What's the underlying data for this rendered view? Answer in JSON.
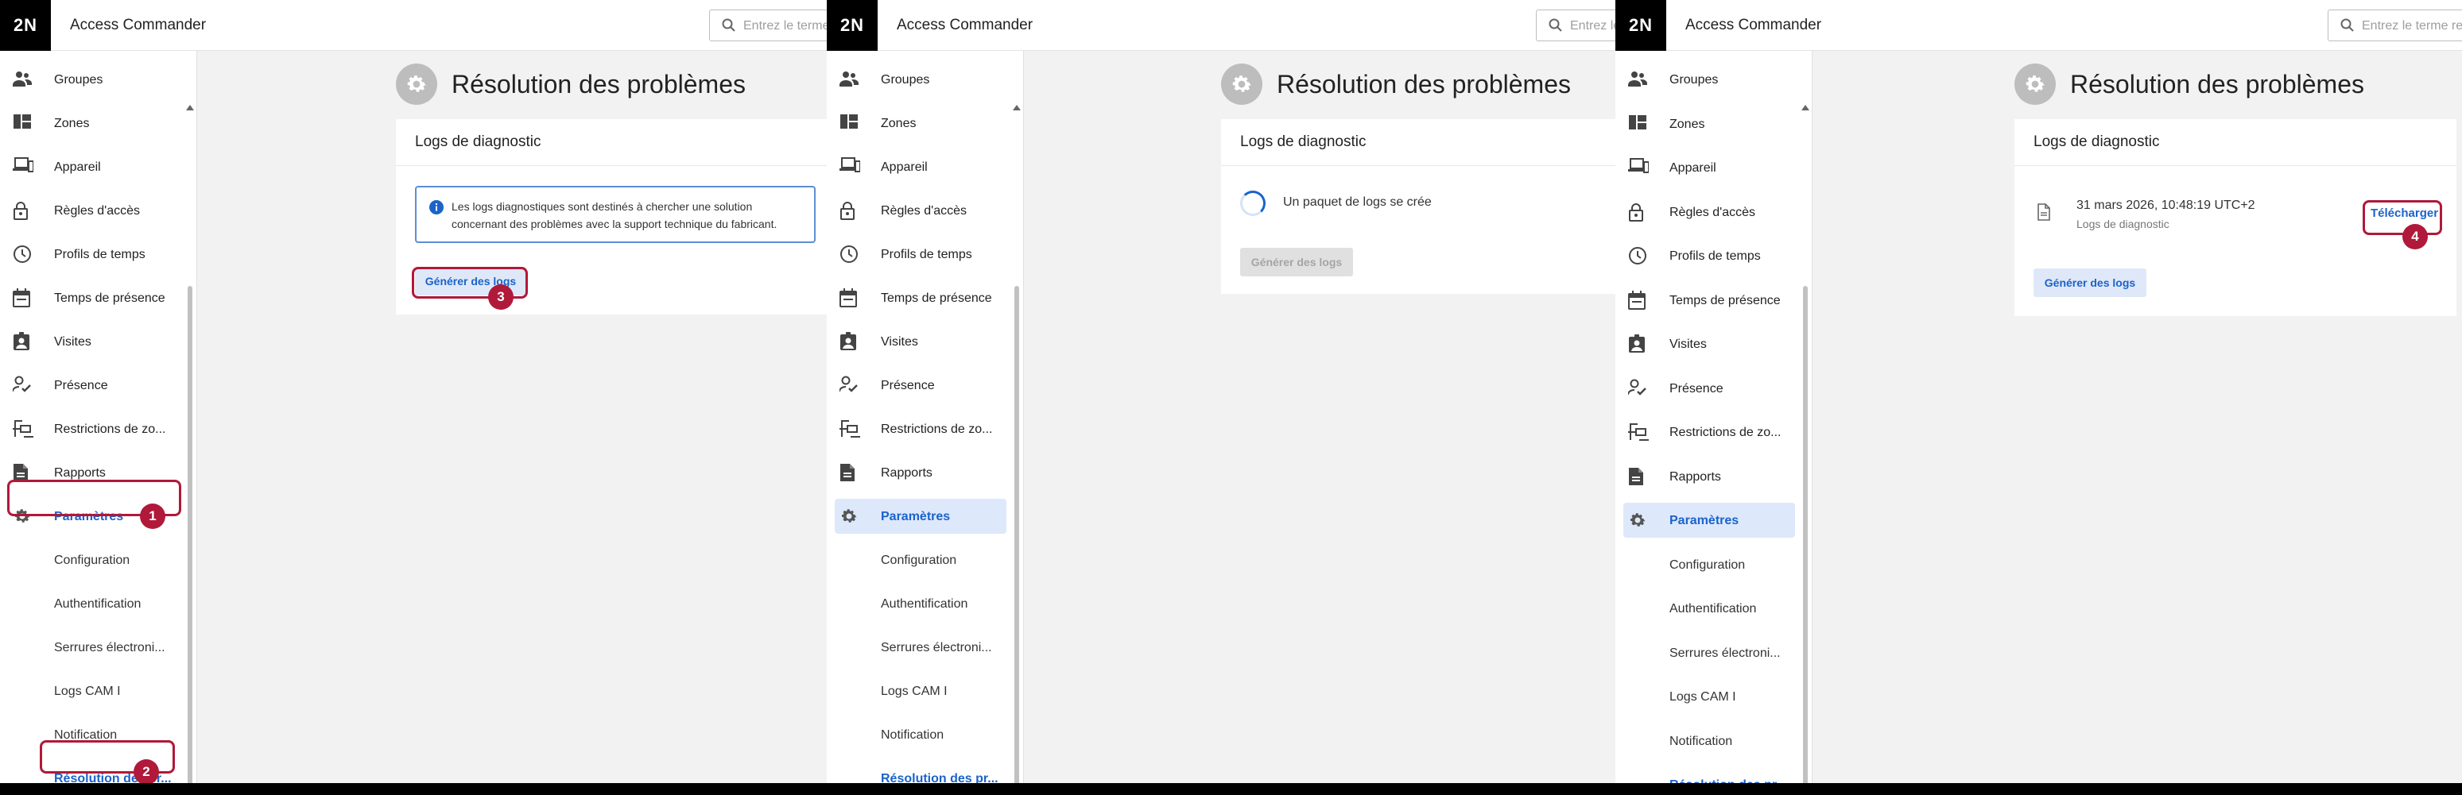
{
  "app": {
    "logo": "2N",
    "title": "Access Commander"
  },
  "search": {
    "placeholder": "Entrez le terme re"
  },
  "nav": [
    {
      "label": "Groupes",
      "icon": "groups-icon"
    },
    {
      "label": "Zones",
      "icon": "zones-icon"
    },
    {
      "label": "Appareil",
      "icon": "devices-icon"
    },
    {
      "label": "Règles d'accès",
      "icon": "lock-icon"
    },
    {
      "label": "Profils de temps",
      "icon": "clock-icon"
    },
    {
      "label": "Temps de présence",
      "icon": "calendar-icon"
    },
    {
      "label": "Visites",
      "icon": "visitor-badge-icon"
    },
    {
      "label": "Présence",
      "icon": "person-check-icon"
    },
    {
      "label": "Restrictions de zo...",
      "icon": "zone-restriction-icon"
    },
    {
      "label": "Rapports",
      "icon": "report-icon"
    },
    {
      "label": "Paramètres",
      "icon": "gear-icon"
    },
    {
      "label": "Configuration",
      "icon": ""
    },
    {
      "label": "Authentification",
      "icon": ""
    },
    {
      "label": "Serrures électroni...",
      "icon": ""
    },
    {
      "label": "Logs CAM I",
      "icon": ""
    },
    {
      "label": "Notification",
      "icon": ""
    },
    {
      "label": "Résolution des pr...",
      "icon": ""
    }
  ],
  "page": {
    "title": "Résolution des problèmes",
    "card_title": "Logs de diagnostic"
  },
  "step1": {
    "info_text": "Les logs diagnostiques sont destinés à chercher une solution concernant des problèmes avec la support technique du fabricant.",
    "generate_label": "Générer des logs"
  },
  "step2": {
    "status_text": "Un paquet de logs se crée",
    "generate_label": "Générer des logs"
  },
  "step3": {
    "log_date": "31 mars 2026, 10:48:19 UTC+2",
    "log_type": "Logs de diagnostic",
    "download_label": "Télécharger",
    "generate_label": "Générer des logs"
  },
  "badges": [
    "1",
    "2",
    "3",
    "4"
  ],
  "colors": {
    "accent": "#1b63c9",
    "highlight": "#b0193a",
    "active_bg": "#dde8fb"
  }
}
